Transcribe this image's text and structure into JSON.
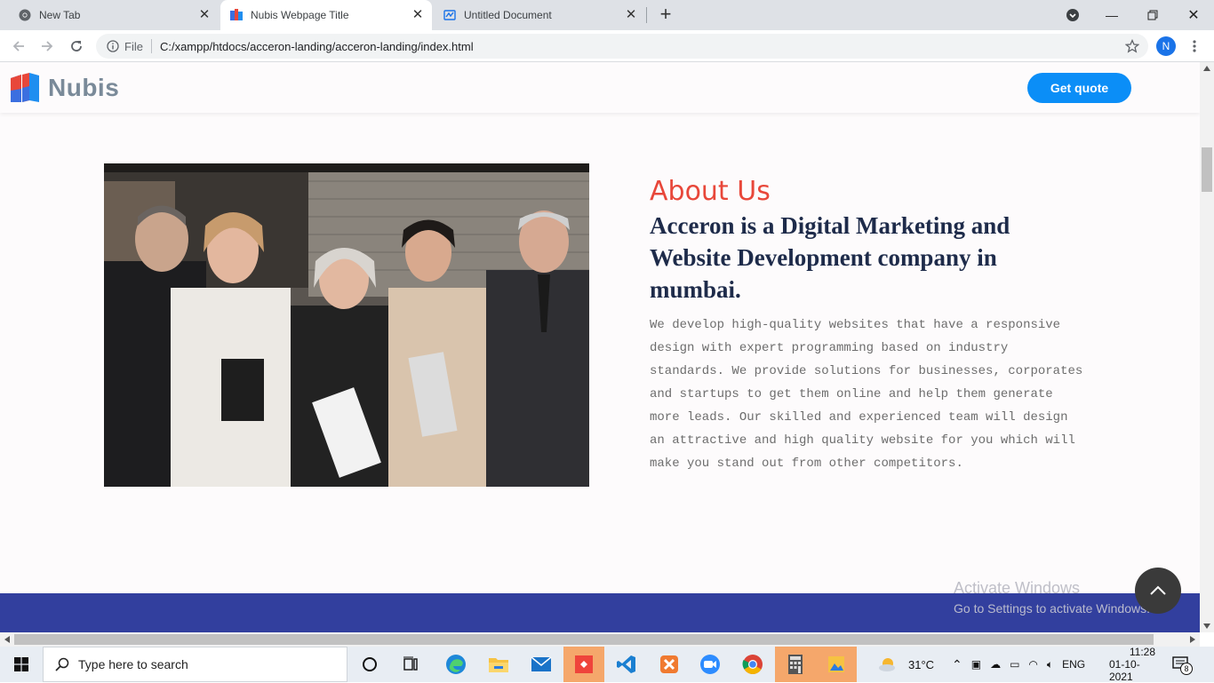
{
  "browser": {
    "tabs": [
      {
        "title": "New Tab",
        "icon": "chrome-icon",
        "active": false
      },
      {
        "title": "Nubis Webpage Title",
        "icon": "nubis-logo-icon",
        "active": true
      },
      {
        "title": "Untitled Document",
        "icon": "document-icon",
        "active": false
      }
    ],
    "address": {
      "scheme_label": "File",
      "url": "C:/xampp/htdocs/acceron-landing/acceron-landing/index.html"
    },
    "profile_initial": "N"
  },
  "site": {
    "brand": "Nubis",
    "cta_label": "Get quote",
    "about": {
      "label": "About Us",
      "heading": "Acceron is a Digital Marketing and Website Development company in mumbai.",
      "body": "We develop high-quality websites that have a responsive design with expert programming based on industry standards. We provide solutions for businesses, corporates and startups to get them online and help them generate more leads. Our skilled and experienced team will design an attractive and high quality website for you which will make you stand out from other competitors."
    },
    "colors": {
      "accent": "#e8473a",
      "primary_button": "#0b8ef7",
      "heading": "#1e2b4a",
      "footer_band": "#323f9e"
    }
  },
  "os": {
    "watermark_title": "Activate Windows",
    "watermark_subtitle": "Go to Settings to activate Windows.",
    "search_placeholder": "Type here to search",
    "weather": "31°C",
    "language": "ENG",
    "time": "11:28",
    "date": "01-10-2021",
    "notification_count": "8"
  }
}
